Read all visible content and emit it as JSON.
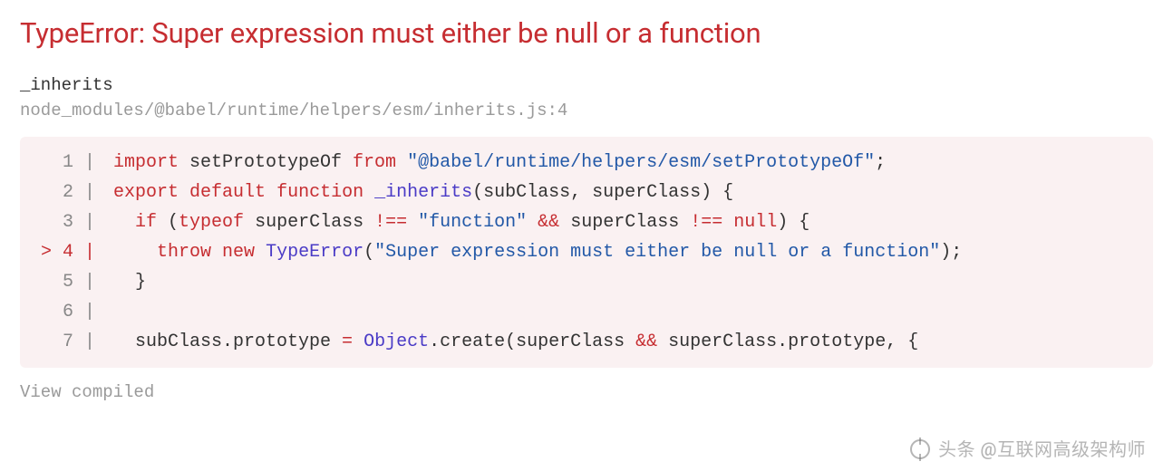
{
  "error": {
    "title": "TypeError: Super expression must either be null or a function"
  },
  "frame": {
    "function_name": "_inherits",
    "file": "node_modules/@babel/runtime/helpers/esm/inherits.js:4"
  },
  "code": {
    "highlighted_line": 4,
    "lines": [
      {
        "num": 1,
        "gutter": "  1 | ",
        "tokens": [
          {
            "t": "import",
            "c": "tk-kw"
          },
          {
            "t": " setPrototypeOf "
          },
          {
            "t": "from",
            "c": "tk-kw"
          },
          {
            "t": " "
          },
          {
            "t": "\"@babel/runtime/helpers/esm/setPrototypeOf\"",
            "c": "tk-str"
          },
          {
            "t": ";"
          }
        ]
      },
      {
        "num": 2,
        "gutter": "  2 | ",
        "tokens": [
          {
            "t": "export",
            "c": "tk-kw"
          },
          {
            "t": " "
          },
          {
            "t": "default",
            "c": "tk-kw"
          },
          {
            "t": " "
          },
          {
            "t": "function",
            "c": "tk-kw"
          },
          {
            "t": " "
          },
          {
            "t": "_inherits",
            "c": "tk-fn"
          },
          {
            "t": "(subClass, superClass) {"
          }
        ]
      },
      {
        "num": 3,
        "gutter": "  3 | ",
        "tokens": [
          {
            "t": "  "
          },
          {
            "t": "if",
            "c": "tk-kw"
          },
          {
            "t": " ("
          },
          {
            "t": "typeof",
            "c": "tk-kw"
          },
          {
            "t": " superClass "
          },
          {
            "t": "!==",
            "c": "tk-op"
          },
          {
            "t": " "
          },
          {
            "t": "\"function\"",
            "c": "tk-str"
          },
          {
            "t": " "
          },
          {
            "t": "&&",
            "c": "tk-op"
          },
          {
            "t": " superClass "
          },
          {
            "t": "!==",
            "c": "tk-op"
          },
          {
            "t": " "
          },
          {
            "t": "null",
            "c": "tk-kw"
          },
          {
            "t": ") {"
          }
        ]
      },
      {
        "num": 4,
        "gutter": "> 4 | ",
        "hl": true,
        "tokens": [
          {
            "t": "    "
          },
          {
            "t": "throw",
            "c": "tk-kw"
          },
          {
            "t": " "
          },
          {
            "t": "new",
            "c": "tk-kw"
          },
          {
            "t": " "
          },
          {
            "t": "TypeError",
            "c": "tk-ident"
          },
          {
            "t": "("
          },
          {
            "t": "\"Super expression must either be null or a function\"",
            "c": "tk-str"
          },
          {
            "t": ");"
          }
        ]
      },
      {
        "num": 5,
        "gutter": "  5 | ",
        "tokens": [
          {
            "t": "  }"
          }
        ]
      },
      {
        "num": 6,
        "gutter": "  6 | ",
        "tokens": []
      },
      {
        "num": 7,
        "gutter": "  7 | ",
        "tokens": [
          {
            "t": "  subClass.prototype "
          },
          {
            "t": "=",
            "c": "tk-op"
          },
          {
            "t": " "
          },
          {
            "t": "Object",
            "c": "tk-ident"
          },
          {
            "t": ".create(superClass "
          },
          {
            "t": "&&",
            "c": "tk-op"
          },
          {
            "t": " superClass.prototype, {"
          }
        ]
      }
    ]
  },
  "footer": {
    "view_compiled": "View compiled"
  },
  "watermark": {
    "text": "头条 @互联网高级架构师"
  }
}
